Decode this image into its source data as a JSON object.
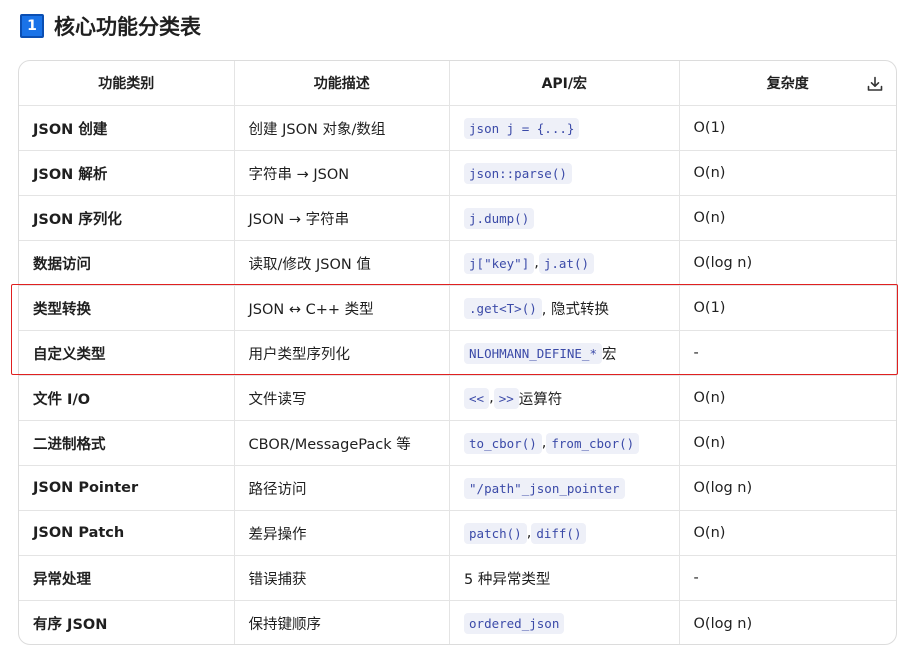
{
  "heading": {
    "number": "1",
    "title": "核心功能分类表"
  },
  "table": {
    "headers": [
      "功能类别",
      "功能描述",
      "API/宏",
      "复杂度"
    ],
    "rows": [
      {
        "category": "JSON 创建",
        "description": "创建 JSON 对象/数组",
        "api": [
          {
            "type": "code",
            "text": "json j = {...}"
          }
        ],
        "complexity": "O(1)"
      },
      {
        "category": "JSON 解析",
        "description": "字符串 → JSON",
        "api": [
          {
            "type": "code",
            "text": "json::parse()"
          }
        ],
        "complexity": "O(n)"
      },
      {
        "category": "JSON 序列化",
        "description": "JSON → 字符串",
        "api": [
          {
            "type": "code",
            "text": "j.dump()"
          }
        ],
        "complexity": "O(n)"
      },
      {
        "category": "数据访问",
        "description": "读取/修改 JSON 值",
        "api": [
          {
            "type": "code",
            "text": "j[\"key\"]"
          },
          {
            "type": "text",
            "text": ","
          },
          {
            "type": "code",
            "text": "j.at()"
          }
        ],
        "complexity": "O(log n)"
      },
      {
        "category": "类型转换",
        "description": "JSON ↔ C++ 类型",
        "api": [
          {
            "type": "code",
            "text": ".get<T>()"
          },
          {
            "type": "text",
            "text": ", 隐式转换"
          }
        ],
        "complexity": "O(1)"
      },
      {
        "category": "自定义类型",
        "description": "用户类型序列化",
        "api": [
          {
            "type": "code",
            "text": "NLOHMANN_DEFINE_*"
          },
          {
            "type": "text",
            "text": " 宏"
          }
        ],
        "complexity": "-"
      },
      {
        "category": "文件 I/O",
        "description": "文件读写",
        "api": [
          {
            "type": "code",
            "text": "<<"
          },
          {
            "type": "text",
            "text": ","
          },
          {
            "type": "code",
            "text": ">>"
          },
          {
            "type": "text",
            "text": " 运算符"
          }
        ],
        "complexity": "O(n)"
      },
      {
        "category": "二进制格式",
        "description": "CBOR/MessagePack 等",
        "api": [
          {
            "type": "code",
            "text": "to_cbor()"
          },
          {
            "type": "text",
            "text": ","
          },
          {
            "type": "code",
            "text": "from_cbor()"
          }
        ],
        "complexity": "O(n)"
      },
      {
        "category": "JSON Pointer",
        "description": "路径访问",
        "api": [
          {
            "type": "code",
            "text": "\"/path\"_json_pointer"
          }
        ],
        "complexity": "O(log n)"
      },
      {
        "category": "JSON Patch",
        "description": "差异操作",
        "api": [
          {
            "type": "code",
            "text": "patch()"
          },
          {
            "type": "text",
            "text": ","
          },
          {
            "type": "code",
            "text": "diff()"
          }
        ],
        "complexity": "O(n)"
      },
      {
        "category": "异常处理",
        "description": "错误捕获",
        "api": [
          {
            "type": "text",
            "text": "5 种异常类型"
          }
        ],
        "complexity": "-"
      },
      {
        "category": "有序 JSON",
        "description": "保持键顺序",
        "api": [
          {
            "type": "code",
            "text": "ordered_json"
          }
        ],
        "complexity": "O(log n)"
      }
    ]
  },
  "icons": {
    "download": "download-icon"
  },
  "colors": {
    "accent": "#1a73e8",
    "highlight_border": "#e02020",
    "code_text": "#3b4aa8",
    "code_bg": "#eef0f8"
  }
}
